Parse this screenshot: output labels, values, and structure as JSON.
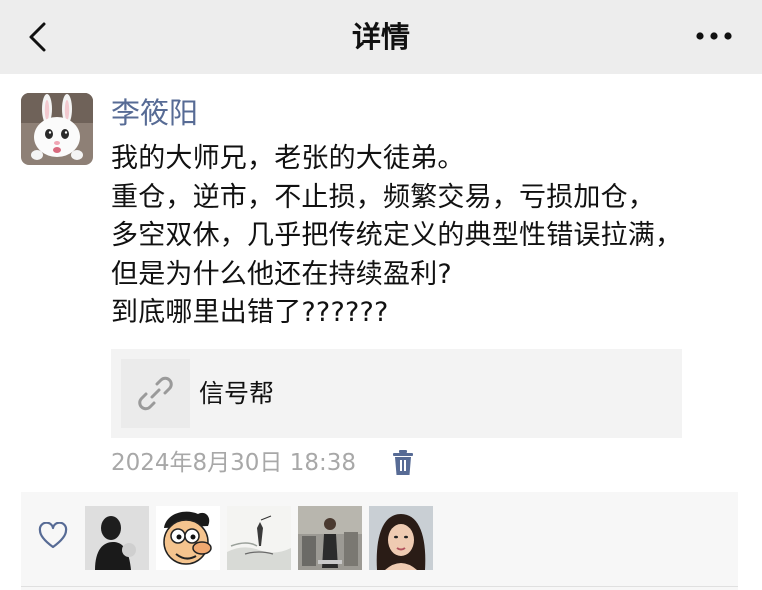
{
  "navbar": {
    "back_icon": "chevron-left-icon",
    "title": "详情",
    "more_icon": "more-dots-icon"
  },
  "post": {
    "author": "李筱阳",
    "avatar_icon": "white-rabbit-avatar",
    "text_lines": [
      "我的大师兄，老张的大徒弟。",
      "重仓，逆市，不止损，频繁交易，亏损加仓，",
      "多空双休，几乎把传统定义的典型性错误拉满，",
      "但是为什么他还在持续盈利?",
      "到底哪里出错了??????"
    ],
    "link": {
      "icon": "link-icon",
      "title": "信号帮"
    },
    "timestamp": "2024年8月30日 18:38",
    "delete_icon": "trash-icon"
  },
  "likes": {
    "icon": "heart-outline-icon",
    "avatars": [
      "person-silhouette-avatar",
      "cartoon-face-avatar",
      "ink-landscape-avatar",
      "gym-photo-avatar",
      "woman-selfie-avatar"
    ]
  },
  "colors": {
    "navbar_bg": "#ededed",
    "author_link": "#576b95",
    "timestamp": "#a8a8a8",
    "delete_icon": "#576b95"
  }
}
